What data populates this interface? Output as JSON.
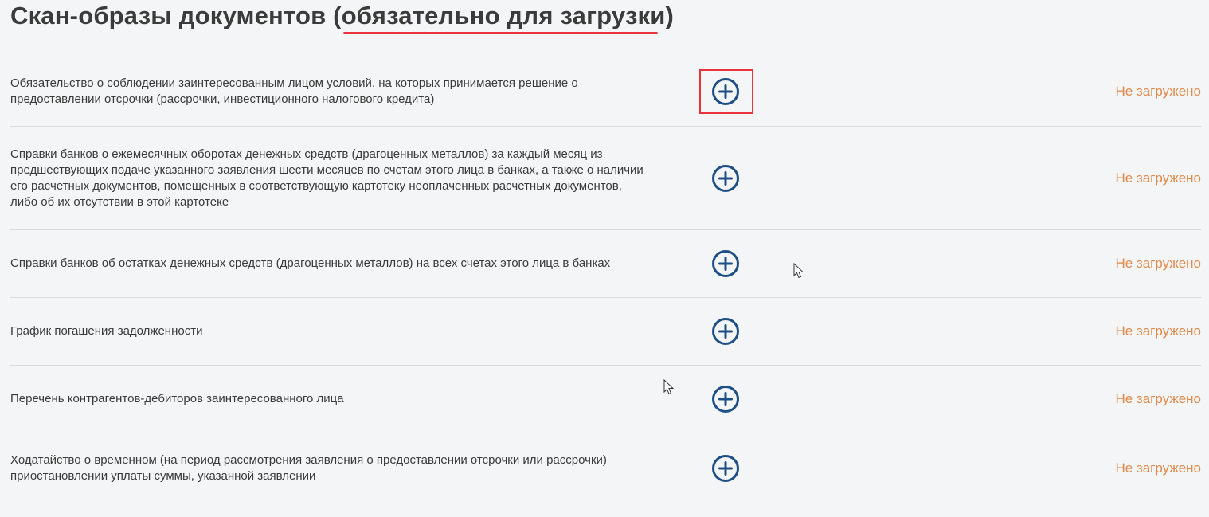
{
  "header": {
    "title_main": "Скан-образы документов ",
    "title_open_paren": "(",
    "title_required": "обязательно для загрузки",
    "title_close_paren": ")",
    "accent_color": "#e8323c"
  },
  "documents": [
    {
      "label": "Обязательство о соблюдении заинтересованным лицом условий, на которых принимается решение о предоставлении отсрочки (рассрочки, инвестиционного налогового кредита)",
      "status": "Не загружено",
      "highlighted": true
    },
    {
      "label": "Справки банков о ежемесячных оборотах денежных средств (драгоценных металлов) за каждый месяц из предшествующих подаче указанного заявления шести месяцев по счетам этого лица в банках, а также о наличии его расчетных документов, помещенных в соответствующую картотеку неоплаченных расчетных документов, либо об их отсутствии в этой картотеке",
      "status": "Не загружено",
      "highlighted": false
    },
    {
      "label": "Справки банков об остатках денежных средств (драгоценных металлов) на всех счетах этого лица в банках",
      "status": "Не загружено",
      "highlighted": false
    },
    {
      "label": "График погашения задолженности",
      "status": "Не загружено",
      "highlighted": false
    },
    {
      "label": "Перечень контрагентов-дебиторов заинтересованного лица",
      "status": "Не загружено",
      "highlighted": false
    },
    {
      "label": "Ходатайство о временном (на период рассмотрения заявления о предоставлении отсрочки или рассрочки) приостановлении уплаты суммы, указанной заявлении",
      "status": "Не загружено",
      "highlighted": false
    }
  ],
  "icons": {
    "add": "plus-circle-icon",
    "cursor": "mouse-pointer-icon"
  },
  "colors": {
    "add_icon": "#1d4f86",
    "status_text": "#e0894a",
    "divider": "#d9dadc"
  }
}
